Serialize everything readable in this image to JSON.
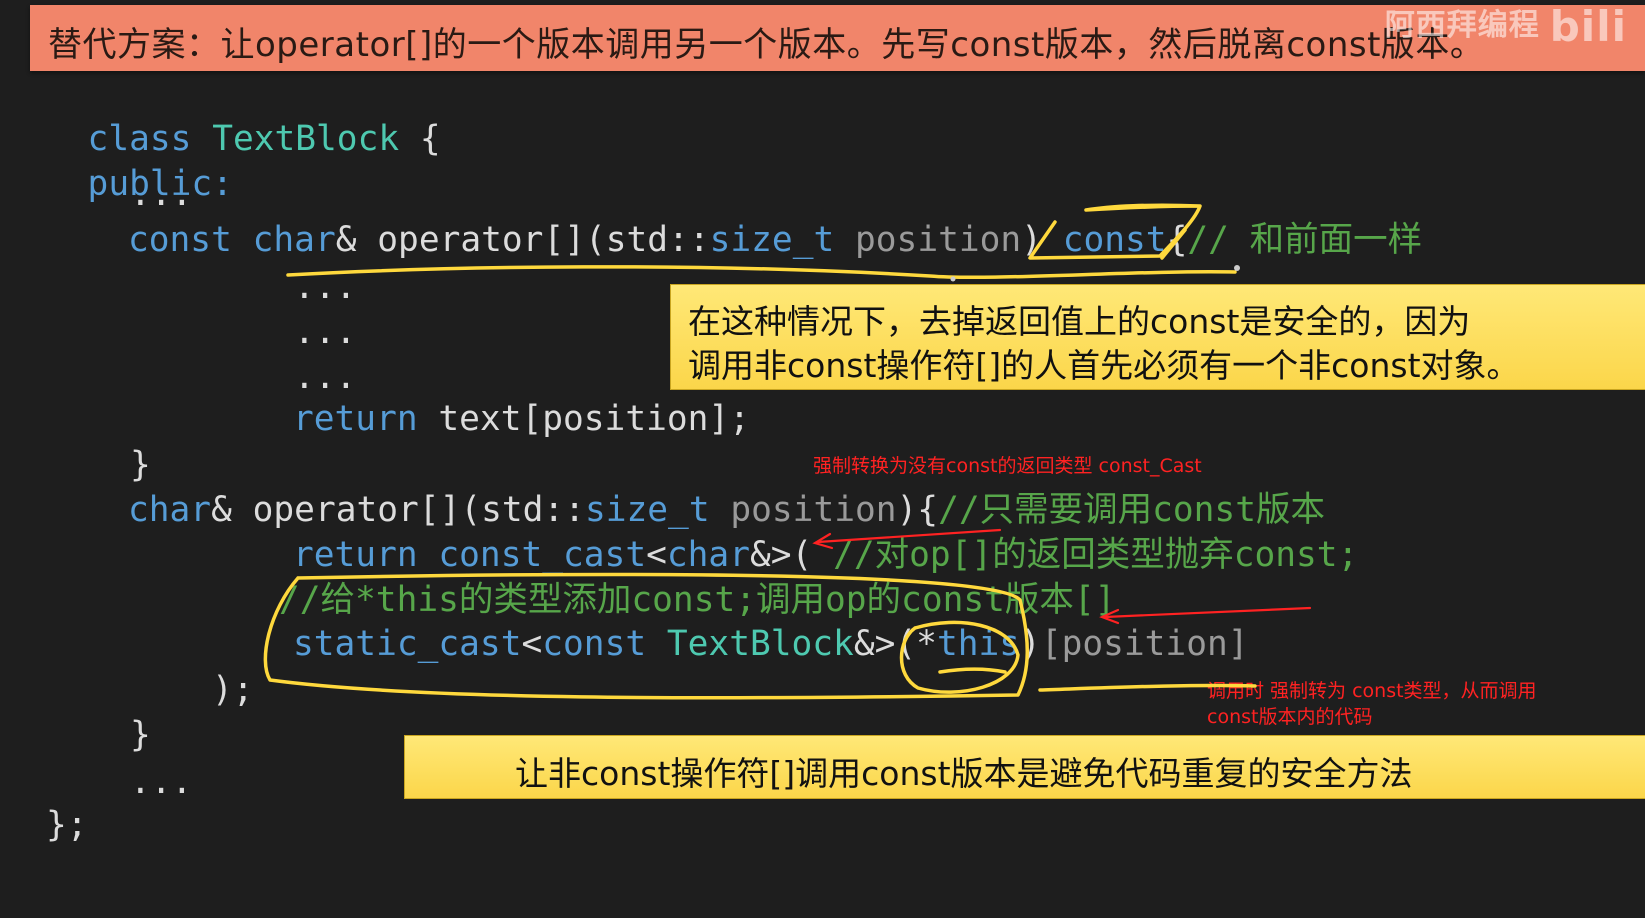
{
  "banner": {
    "title": "替代方案：让operator[]的一个版本调用另一个版本。先写const版本，然后脱离const版本。",
    "watermark": "阿西拜编程",
    "watermark_logo": "bili"
  },
  "code": {
    "l1": {
      "kw": "class",
      "ty": "TextBlock",
      "rest": " {"
    },
    "l2": {
      "kw": "public:"
    },
    "l3": {
      "text": "..."
    },
    "l4": {
      "kw1": "const",
      "kw2": "char",
      "p1": "& operator[](std::",
      "kw3": "size_t",
      "param": " position",
      "p2": ") ",
      "kw4": "const",
      "p3": "{",
      "comment": "// 和前面一样"
    },
    "l5": {
      "text": "..."
    },
    "l6": {
      "text": "..."
    },
    "l7": {
      "text": "..."
    },
    "l8": {
      "kw": "return",
      "rest": " text[position];"
    },
    "l9": {
      "text": "}"
    },
    "l10": {
      "kw1": "char",
      "p1": "& operator[](std::",
      "kw2": "size_t",
      "param": " position",
      "p2": "){",
      "comment": "//只需要调用const版本"
    },
    "l11": {
      "kw": "return",
      "fn": " const_cast",
      "p1": "<",
      "kw2": "char",
      "p2": "&>( ",
      "comment": "//对op[]的返回类型抛弃const;"
    },
    "l12": {
      "comment": "//给*this的类型添加const;调用op的const版本[]"
    },
    "l13": {
      "fn": "static_cast",
      "p1": "<",
      "kw": "const",
      "ty": " TextBlock",
      "p2": "&>(*",
      "kw2": "this",
      "p3": ")",
      "param": "[position]"
    },
    "l14": {
      "text": ");"
    },
    "l15": {
      "text": "}"
    },
    "l16": {
      "text": "..."
    },
    "l17": {
      "text": "};"
    }
  },
  "notes": {
    "box1_line1": "在这种情况下，去掉返回值上的const是安全的，因为",
    "box1_line2": "调用非const操作符[]的人首先必须有一个非const对象。",
    "box2": "让非const操作符[]调用const版本是避免代码重复的安全方法",
    "red1": "强制转换为没有const的返回类型 const_Cast",
    "red2_line1": "调用时 强制转为 const类型，从而调用",
    "red2_line2": "const版本内的代码"
  },
  "colors": {
    "background": "#1e1e1e",
    "keyword": "#569cd6",
    "type": "#4ec9b0",
    "comment": "#57a64a",
    "annotation_red": "#ff2222",
    "highlight_yellow": "#ffd93d",
    "banner": "#f1856a"
  }
}
